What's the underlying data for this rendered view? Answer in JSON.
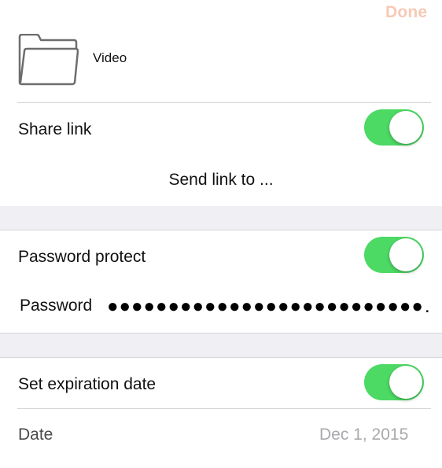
{
  "header": {
    "done_label": "Done"
  },
  "file": {
    "name": "Video",
    "icon": "folder-icon"
  },
  "share": {
    "label": "Share link",
    "enabled": true,
    "send_link_label": "Send link to ..."
  },
  "password": {
    "protect_label": "Password protect",
    "protect_enabled": true,
    "field_label": "Password",
    "value_masked": "●●●●●●●●●●●●●●●●●●●●●●●●●●…"
  },
  "expiration": {
    "label": "Set expiration date",
    "enabled": true,
    "date_label": "Date",
    "date_value": "Dec 1, 2015"
  },
  "colors": {
    "toggle_on": "#4cd964",
    "section_gap": "#efeff4",
    "done_faded": "#f7c9b6"
  }
}
